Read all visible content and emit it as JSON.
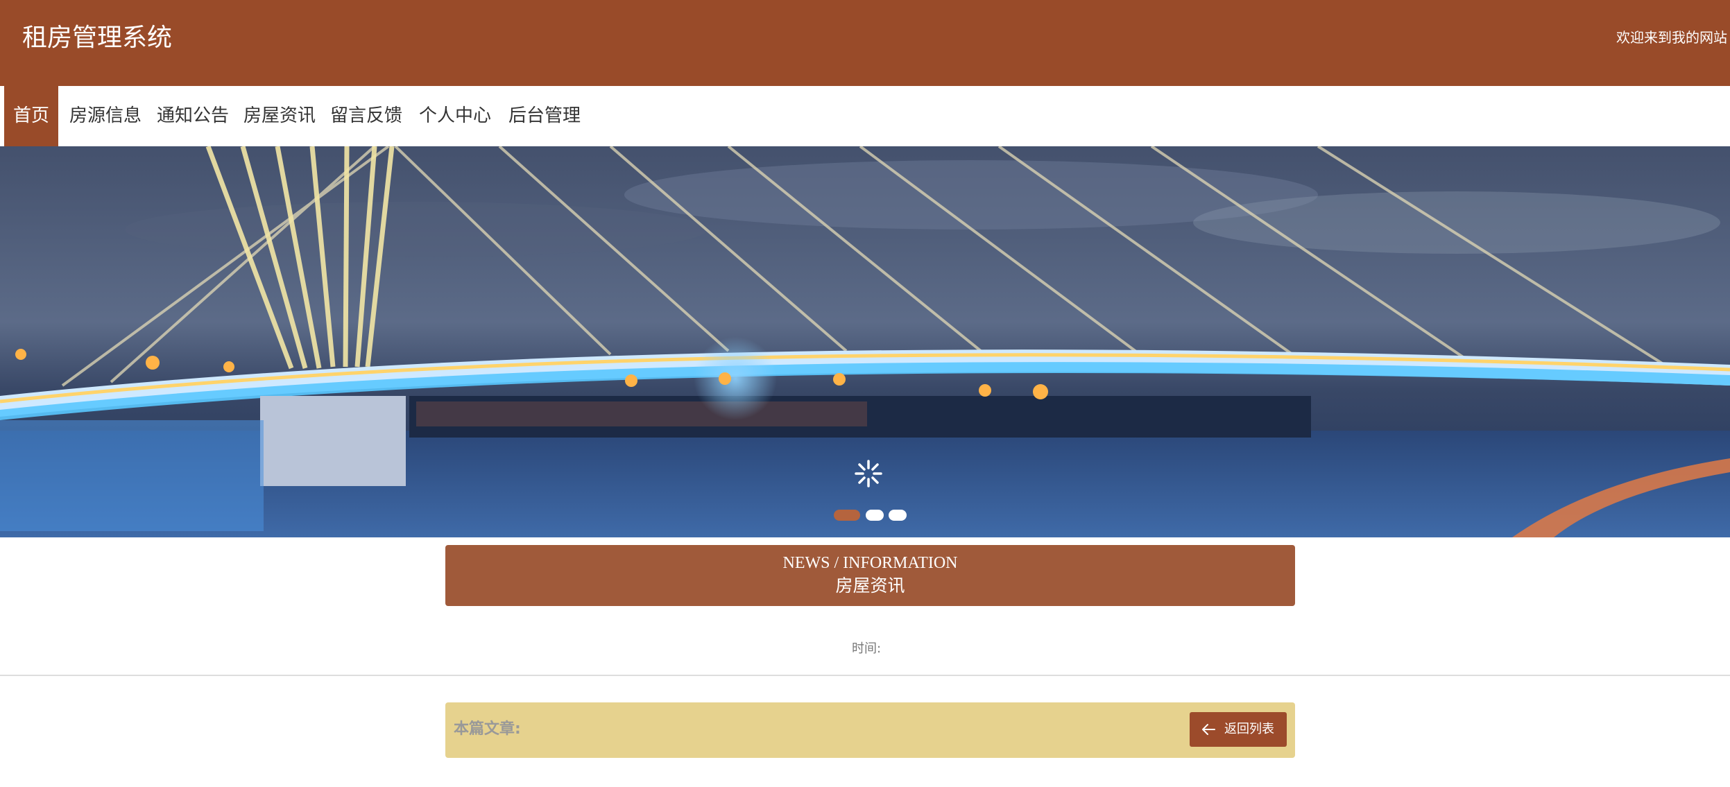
{
  "header": {
    "title": "租房管理系统",
    "welcome": "欢迎来到我的网站"
  },
  "nav": {
    "items": [
      {
        "label": "首页",
        "active": true
      },
      {
        "label": "房源信息"
      },
      {
        "label": "通知公告"
      },
      {
        "label": "房屋资讯"
      },
      {
        "label": "留言反馈"
      },
      {
        "label": "个人中心"
      },
      {
        "label": "后台管理"
      }
    ]
  },
  "banner": {
    "active_slide": 1,
    "slide_count": 3,
    "loading_icon": "spinner-icon"
  },
  "news": {
    "title_en": "NEWS / INFORMATION",
    "title_cn": "房屋资讯"
  },
  "article": {
    "time_label": "时间:",
    "current_label": "本篇文章:",
    "back_label": "返回列表",
    "back_icon": "arrow-left-icon"
  },
  "colors": {
    "primary": "#994b29",
    "news_header": "#a05a3a",
    "article_bar": "#e6d28e",
    "back_button": "#9c4b2b",
    "dot_active": "#b5643e"
  }
}
